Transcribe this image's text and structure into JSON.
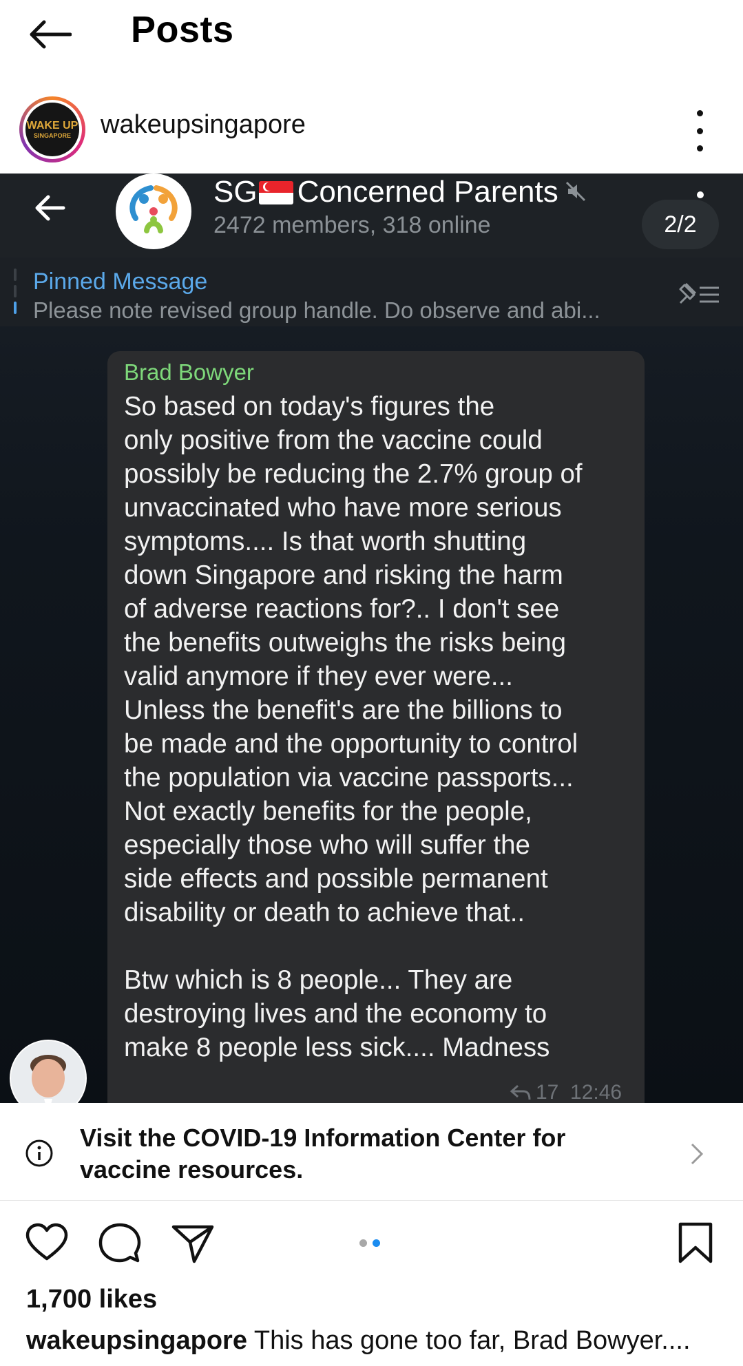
{
  "appbar": {
    "title": "Posts",
    "back_icon": "arrow-left-icon"
  },
  "post": {
    "username": "wakeupsingapore",
    "avatar_text": [
      "WAKE UP",
      "SINGAPORE"
    ],
    "more_icon": "more-vertical-icon"
  },
  "telegram": {
    "group_name_prefix": "SG",
    "group_name_suffix": "Concerned Parents",
    "members": "2472 members, 318 online",
    "page_indicator": "2/2",
    "pinned_label": "Pinned Message",
    "pinned_text": "Please note revised group handle.  Do observe and abi...",
    "message": {
      "sender": "Brad Bowyer",
      "lines": [
        "So based on today's figures the",
        "only positive from the vaccine could",
        "possibly be reducing the 2.7% group of",
        "unvaccinated who have more serious",
        "symptoms.... Is that worth shutting",
        "down Singapore and risking the harm",
        "of adverse reactions for?.. I don't see",
        "the benefits outweighs the risks being",
        "valid anymore if they ever were...",
        "Unless the benefit's are the billions to",
        "be made and the opportunity to control",
        "the population via vaccine passports...",
        "Not exactly benefits for the people,",
        "especially those who will suffer the",
        "side effects and possible permanent",
        "disability or death to achieve that..",
        "",
        "Btw which is 8 people... They are",
        "destroying lives and the economy to",
        "make 8 people less sick.... Madness"
      ],
      "reply_count": "17",
      "time": "12:46"
    }
  },
  "covid_banner": {
    "line1": "Visit the COVID-19 Information Center for",
    "line2": "vaccine resources."
  },
  "actions": {
    "like_icon": "heart-icon",
    "comment_icon": "comment-icon",
    "share_icon": "send-icon",
    "save_icon": "bookmark-icon",
    "carousel_index": 2,
    "carousel_count": 2
  },
  "likes": "1,700 likes",
  "caption": {
    "username": "wakeupsingapore",
    "text": "This has gone too far, Brad Bowyer...."
  },
  "colors": {
    "telegram_bg": "#10161d",
    "bubble": "#2b2c2e",
    "sender_name": "#7ed87a",
    "pinned_label": "#5ba9ea",
    "carousel_active": "#1a8cf0"
  }
}
